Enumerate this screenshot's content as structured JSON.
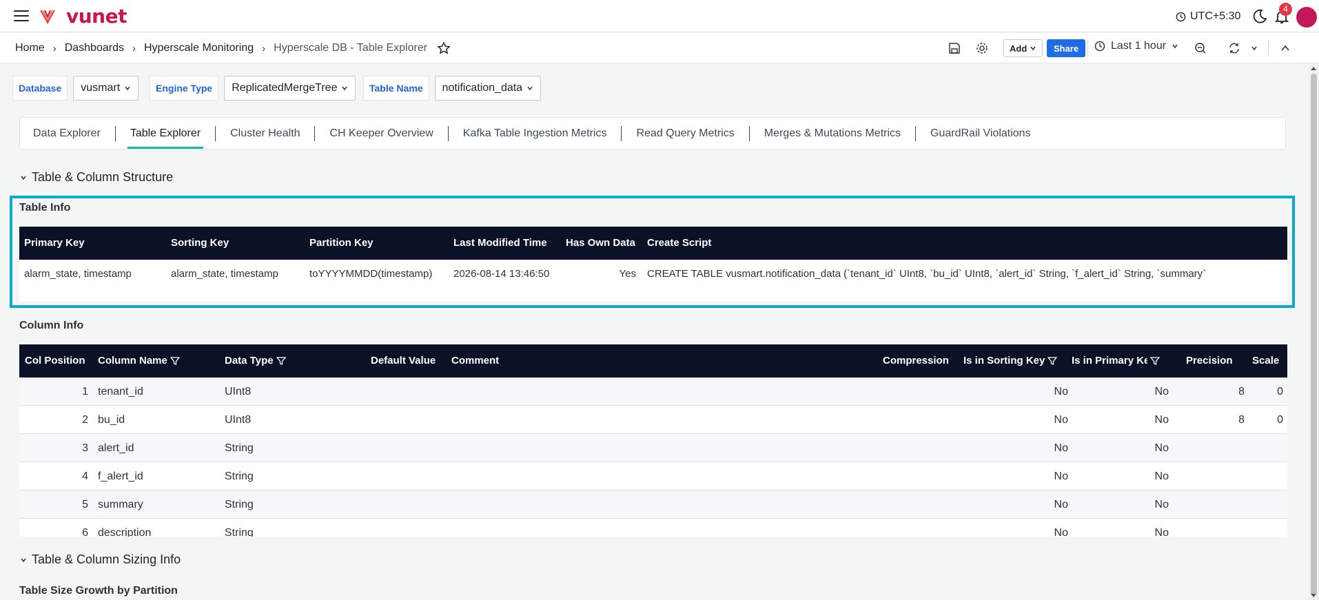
{
  "app": {
    "logo_text": "vunet"
  },
  "header": {
    "timezone": "UTC+5:30",
    "notification_count": "4"
  },
  "breadcrumb": {
    "items": [
      "Home",
      "Dashboards",
      "Hyperscale Monitoring",
      "Hyperscale DB - Table Explorer"
    ]
  },
  "toolbar": {
    "add_label": "Add",
    "share_label": "Share",
    "time_range": "Last 1 hour"
  },
  "filters": [
    {
      "label": "Database",
      "value": "vusmart"
    },
    {
      "label": "Engine Type",
      "value": "ReplicatedMergeTree"
    },
    {
      "label": "Table Name",
      "value": "notification_data"
    }
  ],
  "tabs": [
    "Data Explorer",
    "Table Explorer",
    "Cluster Health",
    "CH Keeper Overview",
    "Kafka Table Ingestion Metrics",
    "Read Query Metrics",
    "Merges & Mutations Metrics",
    "GuardRail Violations"
  ],
  "active_tab": "Table Explorer",
  "sections": {
    "structure": "Table & Column Structure",
    "sizing": "Table & Column Sizing Info"
  },
  "table_info": {
    "title": "Table Info",
    "columns": [
      "Primary Key",
      "Sorting Key",
      "Partition Key",
      "Last Modified Time",
      "Has Own Data",
      "Create Script"
    ],
    "row": [
      "alarm_state, timestamp",
      "alarm_state, timestamp",
      "toYYYYMMDD(timestamp)",
      "2026-08-14 13:46:50",
      "Yes",
      "CREATE TABLE vusmart.notification_data (`tenant_id` UInt8, `bu_id` UInt8, `alert_id` String, `f_alert_id` String, `summary`"
    ]
  },
  "column_info": {
    "title": "Column Info",
    "columns": [
      "Col Position",
      "Column Name",
      "Data Type",
      "Default Value",
      "Comment",
      "Compression",
      "Is in Sorting Key",
      "Is in Primary Key",
      "Precision",
      "Scale"
    ],
    "rows": [
      [
        "1",
        "tenant_id",
        "UInt8",
        "",
        "",
        "",
        "No",
        "No",
        "8",
        "0"
      ],
      [
        "2",
        "bu_id",
        "UInt8",
        "",
        "",
        "",
        "No",
        "No",
        "8",
        "0"
      ],
      [
        "3",
        "alert_id",
        "String",
        "",
        "",
        "",
        "No",
        "No",
        "",
        ""
      ],
      [
        "4",
        "f_alert_id",
        "String",
        "",
        "",
        "",
        "No",
        "No",
        "",
        ""
      ],
      [
        "5",
        "summary",
        "String",
        "",
        "",
        "",
        "No",
        "No",
        "",
        ""
      ],
      [
        "6",
        "description",
        "String",
        "",
        "",
        "",
        "No",
        "No",
        "",
        ""
      ]
    ]
  },
  "sizing": {
    "panel_title": "Table Size Growth by Partition"
  }
}
